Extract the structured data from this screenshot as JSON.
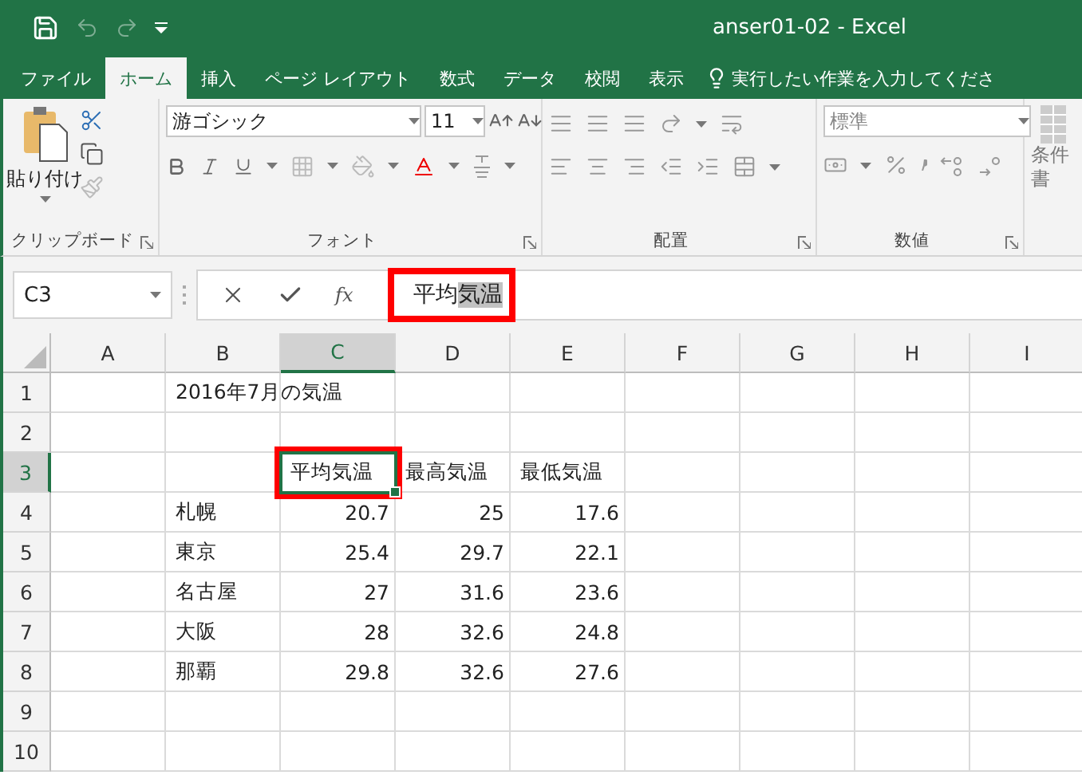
{
  "window": {
    "title": "anser01-02  -  Excel"
  },
  "tabs": [
    {
      "label": "ファイル",
      "selected": false
    },
    {
      "label": "ホーム",
      "selected": true
    },
    {
      "label": "挿入",
      "selected": false
    },
    {
      "label": "ページ レイアウト",
      "selected": false
    },
    {
      "label": "数式",
      "selected": false
    },
    {
      "label": "データ",
      "selected": false
    },
    {
      "label": "校閲",
      "selected": false
    },
    {
      "label": "表示",
      "selected": false
    }
  ],
  "tell_me": {
    "placeholder": "実行したい作業を入力してくださ"
  },
  "ribbon": {
    "clipboard": {
      "paste_label": "貼り付け",
      "group_label": "クリップボード"
    },
    "font": {
      "font_name": "游ゴシック",
      "font_size": "11",
      "group_label": "フォント"
    },
    "alignment": {
      "group_label": "配置"
    },
    "number": {
      "format": "標準",
      "group_label": "数値"
    },
    "conditional": {
      "label_lines": [
        "条件",
        "書"
      ]
    }
  },
  "formula_bar": {
    "name_box": "C3",
    "function_label": "fx",
    "formula_plain": "平均",
    "formula_selected": "気温",
    "highlighted": true
  },
  "columns": [
    {
      "label": "A",
      "selected": false
    },
    {
      "label": "B",
      "selected": false
    },
    {
      "label": "C",
      "selected": true
    },
    {
      "label": "D",
      "selected": false
    },
    {
      "label": "E",
      "selected": false
    },
    {
      "label": "F",
      "selected": false
    },
    {
      "label": "G",
      "selected": false
    },
    {
      "label": "H",
      "selected": false
    },
    {
      "label": "I",
      "selected": false
    }
  ],
  "rows": [
    {
      "number": "1",
      "selected": false,
      "cells": [
        null,
        {
          "text": "2016年7月の気温",
          "kind": "text",
          "selected": false,
          "highlighted": false
        }
      ]
    },
    {
      "number": "2",
      "selected": false,
      "cells": []
    },
    {
      "number": "3",
      "selected": true,
      "cells": [
        null,
        null,
        {
          "text": "平均気温",
          "kind": "text",
          "selected": true,
          "highlighted": true
        },
        {
          "text": "最高気温",
          "kind": "text",
          "selected": false,
          "highlighted": false
        },
        {
          "text": "最低気温",
          "kind": "text",
          "selected": false,
          "highlighted": false
        }
      ]
    },
    {
      "number": "4",
      "selected": false,
      "cells": [
        null,
        {
          "text": "札幌",
          "kind": "text",
          "selected": false,
          "highlighted": false
        },
        {
          "text": "20.7",
          "kind": "number",
          "selected": false,
          "highlighted": false
        },
        {
          "text": "25",
          "kind": "number",
          "selected": false,
          "highlighted": false
        },
        {
          "text": "17.6",
          "kind": "number",
          "selected": false,
          "highlighted": false
        }
      ]
    },
    {
      "number": "5",
      "selected": false,
      "cells": [
        null,
        {
          "text": "東京",
          "kind": "text",
          "selected": false,
          "highlighted": false
        },
        {
          "text": "25.4",
          "kind": "number",
          "selected": false,
          "highlighted": false
        },
        {
          "text": "29.7",
          "kind": "number",
          "selected": false,
          "highlighted": false
        },
        {
          "text": "22.1",
          "kind": "number",
          "selected": false,
          "highlighted": false
        }
      ]
    },
    {
      "number": "6",
      "selected": false,
      "cells": [
        null,
        {
          "text": "名古屋",
          "kind": "text",
          "selected": false,
          "highlighted": false
        },
        {
          "text": "27",
          "kind": "number",
          "selected": false,
          "highlighted": false
        },
        {
          "text": "31.6",
          "kind": "number",
          "selected": false,
          "highlighted": false
        },
        {
          "text": "23.6",
          "kind": "number",
          "selected": false,
          "highlighted": false
        }
      ]
    },
    {
      "number": "7",
      "selected": false,
      "cells": [
        null,
        {
          "text": "大阪",
          "kind": "text",
          "selected": false,
          "highlighted": false
        },
        {
          "text": "28",
          "kind": "number",
          "selected": false,
          "highlighted": false
        },
        {
          "text": "32.6",
          "kind": "number",
          "selected": false,
          "highlighted": false
        },
        {
          "text": "24.8",
          "kind": "number",
          "selected": false,
          "highlighted": false
        }
      ]
    },
    {
      "number": "8",
      "selected": false,
      "cells": [
        null,
        {
          "text": "那覇",
          "kind": "text",
          "selected": false,
          "highlighted": false
        },
        {
          "text": "29.8",
          "kind": "number",
          "selected": false,
          "highlighted": false
        },
        {
          "text": "32.6",
          "kind": "number",
          "selected": false,
          "highlighted": false
        },
        {
          "text": "27.6",
          "kind": "number",
          "selected": false,
          "highlighted": false
        }
      ]
    },
    {
      "number": "9",
      "selected": false,
      "cells": []
    },
    {
      "number": "10",
      "selected": false,
      "cells": []
    }
  ]
}
